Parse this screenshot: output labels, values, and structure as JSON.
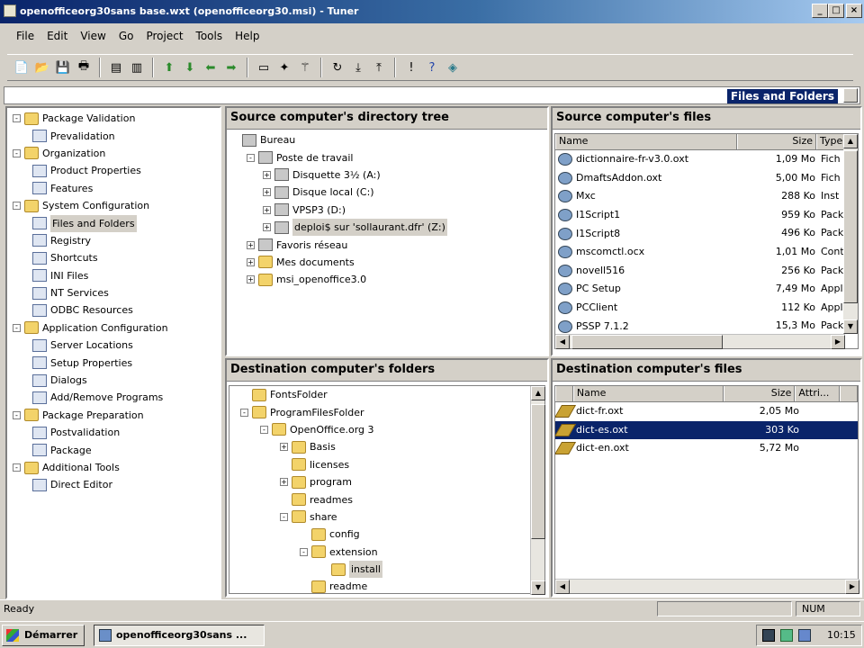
{
  "window": {
    "title": "openofficeorg30sans base.wxt (openofficeorg30.msi) - Tuner"
  },
  "menu": [
    "File",
    "Edit",
    "View",
    "Go",
    "Project",
    "Tools",
    "Help"
  ],
  "toolbar_icons": [
    "new-icon",
    "open-icon",
    "save-icon",
    "print-icon",
    "view-left-icon",
    "view-right-icon",
    "up-arrow-icon",
    "down-arrow-icon",
    "back-arrow-icon",
    "forward-arrow-icon",
    "dialog-icon",
    "wizard-icon",
    "wand-icon",
    "refresh-icon",
    "import-icon",
    "export-icon",
    "info-icon",
    "help-icon",
    "map-icon"
  ],
  "path": {
    "label": "Files and Folders"
  },
  "nav_tree": [
    {
      "label": "Package Validation",
      "level": 0,
      "type": "folder"
    },
    {
      "label": "Prevalidation",
      "level": 1,
      "type": "item"
    },
    {
      "label": "Organization",
      "level": 0,
      "type": "folder"
    },
    {
      "label": "Product Properties",
      "level": 1,
      "type": "item"
    },
    {
      "label": "Features",
      "level": 1,
      "type": "item"
    },
    {
      "label": "System Configuration",
      "level": 0,
      "type": "folder"
    },
    {
      "label": "Files and Folders",
      "level": 1,
      "type": "item",
      "selected": true
    },
    {
      "label": "Registry",
      "level": 1,
      "type": "item"
    },
    {
      "label": "Shortcuts",
      "level": 1,
      "type": "item"
    },
    {
      "label": "INI Files",
      "level": 1,
      "type": "item"
    },
    {
      "label": "NT Services",
      "level": 1,
      "type": "item"
    },
    {
      "label": "ODBC Resources",
      "level": 1,
      "type": "item"
    },
    {
      "label": "Application Configuration",
      "level": 0,
      "type": "folder"
    },
    {
      "label": "Server Locations",
      "level": 1,
      "type": "item"
    },
    {
      "label": "Setup Properties",
      "level": 1,
      "type": "item"
    },
    {
      "label": "Dialogs",
      "level": 1,
      "type": "item"
    },
    {
      "label": "Add/Remove Programs",
      "level": 1,
      "type": "item"
    },
    {
      "label": "Package Preparation",
      "level": 0,
      "type": "folder"
    },
    {
      "label": "Postvalidation",
      "level": 1,
      "type": "item"
    },
    {
      "label": "Package",
      "level": 1,
      "type": "item"
    },
    {
      "label": "Additional Tools",
      "level": 0,
      "type": "folder"
    },
    {
      "label": "Direct Editor",
      "level": 1,
      "type": "item"
    }
  ],
  "source_tree": {
    "title": "Source computer's directory tree",
    "nodes": [
      {
        "label": "Bureau",
        "level": 0,
        "icon": "drive",
        "exp": ""
      },
      {
        "label": "Poste de travail",
        "level": 1,
        "icon": "drive",
        "exp": "-"
      },
      {
        "label": "Disquette 3½ (A:)",
        "level": 2,
        "icon": "drive",
        "exp": "+"
      },
      {
        "label": "Disque local (C:)",
        "level": 2,
        "icon": "drive",
        "exp": "+"
      },
      {
        "label": "VPSP3 (D:)",
        "level": 2,
        "icon": "drive",
        "exp": "+"
      },
      {
        "label": "deploi$ sur 'sollaurant.dfr' (Z:)",
        "level": 2,
        "icon": "drive",
        "exp": "+",
        "selected": true
      },
      {
        "label": "Favoris réseau",
        "level": 1,
        "icon": "drive",
        "exp": "+"
      },
      {
        "label": "Mes documents",
        "level": 1,
        "icon": "folder",
        "exp": "+"
      },
      {
        "label": "msi_openoffice3.0",
        "level": 1,
        "icon": "folder",
        "exp": "+"
      }
    ]
  },
  "source_files": {
    "title": "Source computer's files",
    "columns": [
      "Name",
      "Size",
      "Type"
    ],
    "rows": [
      {
        "name": "dictionnaire-fr-v3.0.oxt",
        "size": "1,09 Mo",
        "type": "Fich"
      },
      {
        "name": "DmaftsAddon.oxt",
        "size": "5,00 Mo",
        "type": "Fich"
      },
      {
        "name": "Mxc",
        "size": "288 Ko",
        "type": "Inst"
      },
      {
        "name": "I1Script1",
        "size": "959 Ko",
        "type": "Pack"
      },
      {
        "name": "I1Script8",
        "size": "496 Ko",
        "type": "Pack"
      },
      {
        "name": "mscomctl.ocx",
        "size": "1,01 Mo",
        "type": "Cont"
      },
      {
        "name": "novell516",
        "size": "256 Ko",
        "type": "Pack"
      },
      {
        "name": "PC Setup",
        "size": "7,49 Mo",
        "type": "Appl"
      },
      {
        "name": "PCClient",
        "size": "112 Ko",
        "type": "Appl"
      },
      {
        "name": "PSSP 7.1.2",
        "size": "15,3 Mo",
        "type": "Pack"
      }
    ]
  },
  "dest_tree": {
    "title": "Destination computer's folders",
    "nodes": [
      {
        "label": "FontsFolder",
        "level": 0,
        "exp": ""
      },
      {
        "label": "ProgramFilesFolder",
        "level": 0,
        "exp": "-"
      },
      {
        "label": "OpenOffice.org 3",
        "level": 1,
        "exp": "-"
      },
      {
        "label": "Basis",
        "level": 2,
        "exp": "+"
      },
      {
        "label": "licenses",
        "level": 2,
        "exp": ""
      },
      {
        "label": "program",
        "level": 2,
        "exp": "+"
      },
      {
        "label": "readmes",
        "level": 2,
        "exp": ""
      },
      {
        "label": "share",
        "level": 2,
        "exp": "-"
      },
      {
        "label": "config",
        "level": 3,
        "exp": ""
      },
      {
        "label": "extension",
        "level": 3,
        "exp": "-"
      },
      {
        "label": "install",
        "level": 4,
        "exp": "",
        "selected": true
      },
      {
        "label": "readme",
        "level": 3,
        "exp": ""
      }
    ]
  },
  "dest_files": {
    "title": "Destination computer's files",
    "columns": [
      "Name",
      "Size",
      "Attri...",
      ""
    ],
    "rows": [
      {
        "name": "dict-fr.oxt",
        "size": "2,05 Mo",
        "attr": ""
      },
      {
        "name": "dict-es.oxt",
        "size": "303 Ko",
        "attr": "",
        "selected": true
      },
      {
        "name": "dict-en.oxt",
        "size": "5,72 Mo",
        "attr": ""
      }
    ]
  },
  "status": {
    "text": "Ready",
    "num": "NUM"
  },
  "taskbar": {
    "start": "Démarrer",
    "task": "openofficeorg30sans ...",
    "clock": "10:15"
  }
}
